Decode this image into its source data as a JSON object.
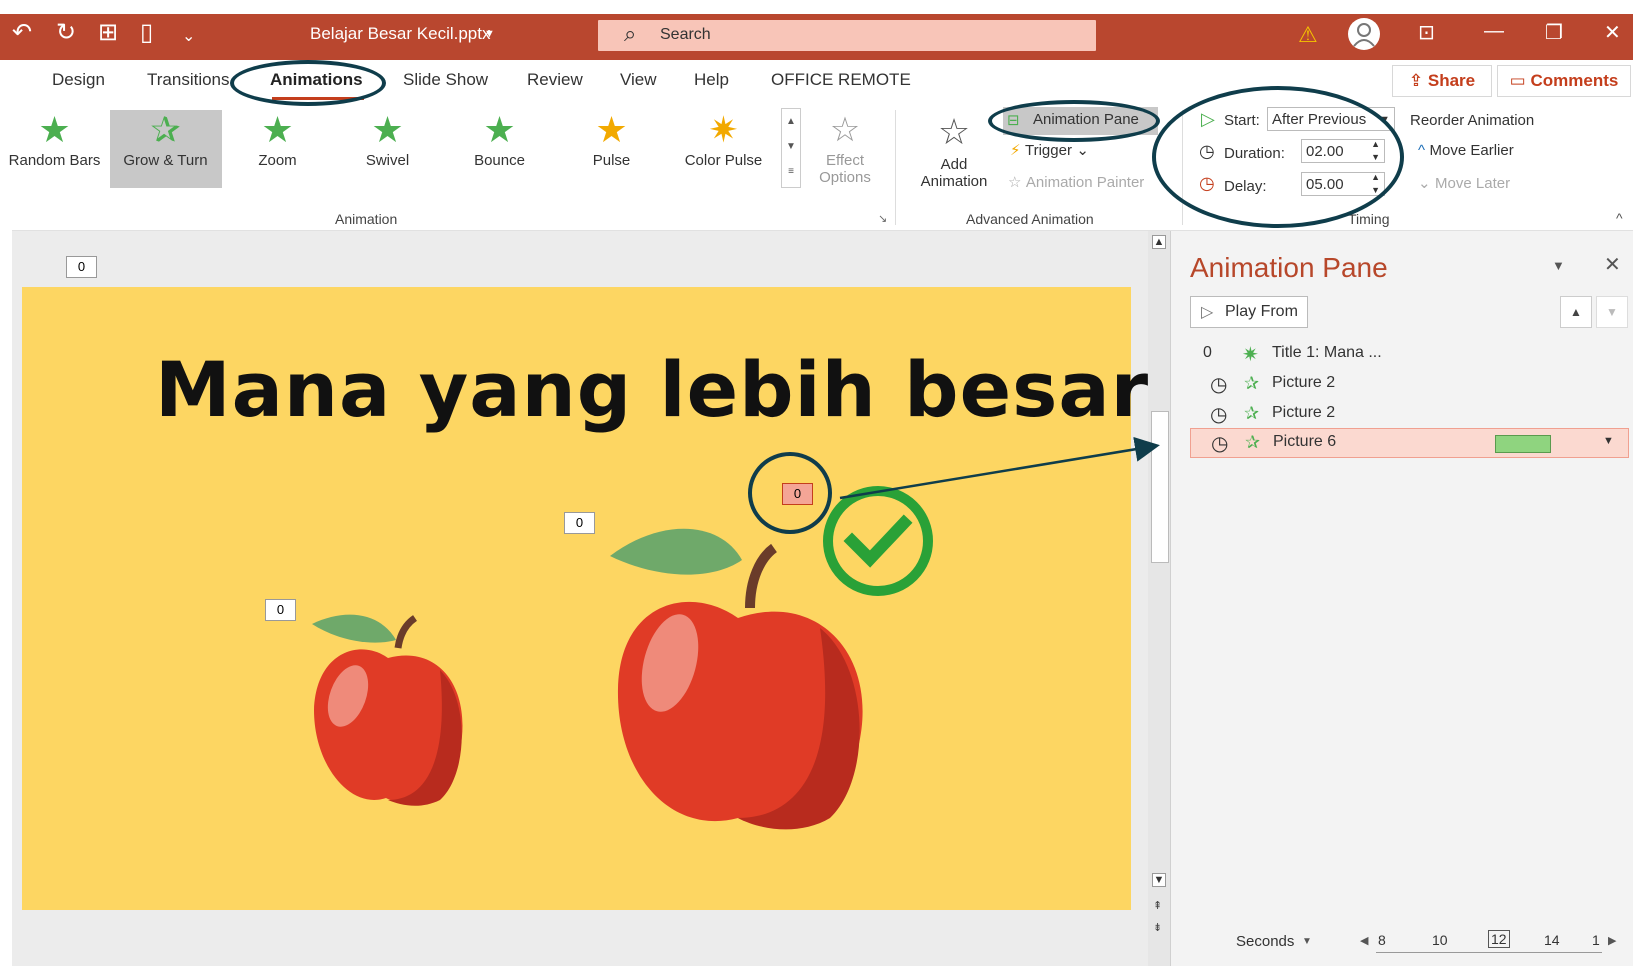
{
  "window": {
    "title": "Belajar Besar Kecil.pptx",
    "search_placeholder": "Search"
  },
  "tabs": [
    "Design",
    "Transitions",
    "Animations",
    "Slide Show",
    "Review",
    "View",
    "Help",
    "OFFICE REMOTE"
  ],
  "top_buttons": {
    "share": "Share",
    "comments": "Comments"
  },
  "gallery": [
    {
      "label": "Random Bars"
    },
    {
      "label": "Grow & Turn"
    },
    {
      "label": "Zoom"
    },
    {
      "label": "Swivel"
    },
    {
      "label": "Bounce"
    },
    {
      "label": "Pulse"
    },
    {
      "label": "Color Pulse"
    }
  ],
  "effect_options": {
    "line1": "Effect",
    "line2": "Options"
  },
  "group_labels": {
    "animation": "Animation",
    "advanced": "Advanced Animation",
    "timing": "Timing"
  },
  "advanced": {
    "add_line1": "Add",
    "add_line2": "Animation",
    "pane_button": "Animation Pane",
    "trigger": "Trigger",
    "painter": "Animation Painter"
  },
  "timing": {
    "start_label": "Start:",
    "start_value": "After Previous",
    "duration_label": "Duration:",
    "duration_value": "02.00",
    "delay_label": "Delay:",
    "delay_value": "05.00",
    "reorder": "Reorder Animation",
    "move_earlier": "Move Earlier",
    "move_later": "Move Later"
  },
  "slide": {
    "title": "Mana yang lebih besar?",
    "tags": {
      "top_left": "0",
      "title_tag": "0",
      "small_apple": "0",
      "big_apple": "0",
      "picture6": "0"
    }
  },
  "pane": {
    "title": "Animation Pane",
    "play_from": "Play From",
    "items": [
      {
        "index": "0",
        "label": "Title 1: Mana ..."
      },
      {
        "index": "",
        "label": "Picture 2"
      },
      {
        "index": "",
        "label": "Picture 2"
      },
      {
        "index": "",
        "label": "Picture 6"
      }
    ],
    "seconds_label": "Seconds",
    "timeline": [
      "8",
      "10",
      "12",
      "14",
      "1"
    ]
  },
  "colors": {
    "accent": "#b9472f",
    "slide_bg": "#fdd662",
    "selected_row": "#fbd9d0",
    "annotation": "#0f3d4b"
  }
}
